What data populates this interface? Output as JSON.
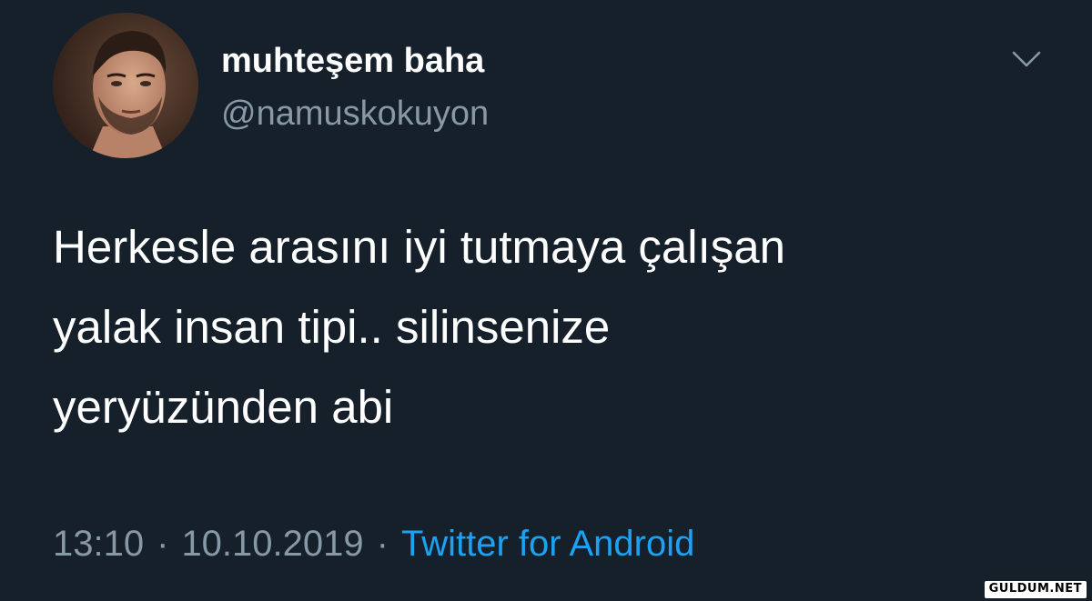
{
  "user": {
    "display_name": "muhteşem baha",
    "handle": "@namuskokuyon"
  },
  "tweet": {
    "lines": [
      "Herkesle arasını iyi tutmaya çalışan",
      "yalak insan tipi.. silinsenize",
      "yeryüzünden abi"
    ]
  },
  "meta": {
    "time": "13:10",
    "separator": "·",
    "date": "10.10.2019",
    "source": "Twitter for Android"
  },
  "icons": {
    "menu": "chevron-down-icon"
  },
  "watermark": "GULDUM.NET",
  "colors": {
    "background": "#15202b",
    "text": "#ffffff",
    "secondary": "#8899a6",
    "link": "#1da1f2"
  }
}
